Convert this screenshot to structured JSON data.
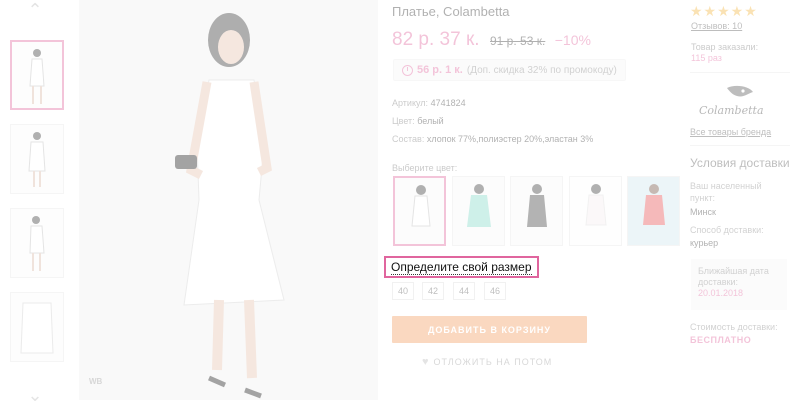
{
  "gallery": {
    "up_icon": "chevron-up",
    "down_icon": "chevron-down",
    "watermark": "WB"
  },
  "product": {
    "title": "Платье, Colambetta",
    "price": "82 р. 37 к.",
    "old_price": "91 р. 53 к.",
    "discount": "−10%",
    "promo_price": "56 р. 1 к.",
    "promo_note": "(Доп. скидка 32% по промокоду)",
    "article_label": "Артикул:",
    "article_value": "4741824",
    "color_label": "Цвет:",
    "color_value": "белый",
    "composition_label": "Состав:",
    "composition_value": "хлопок 77%,полиэстер 20%,эластан 3%",
    "choose_color": "Выберите цвет:",
    "swatch_colors": [
      "#f4f4f4",
      "#7fd8c6",
      "#3a3a3a",
      "#f7eef0",
      "#e54a4c"
    ],
    "size_link": "Определите свой размер",
    "sizes": [
      "40",
      "42",
      "44",
      "46"
    ],
    "add_to_cart": "ДОБАВИТЬ В КОРЗИНУ",
    "save_later": "ОТЛОЖИТЬ НА ПОТОМ"
  },
  "sidebar": {
    "stars": "★★★★★",
    "reviews": "Отзывов: 10",
    "ordered_label": "Товар заказали:",
    "ordered_value": "115 раз",
    "brand_name": "Colambetta",
    "brand_link": "Все товары бренда",
    "delivery_title": "Условия доставки",
    "city_label": "Ваш населенный пункт:",
    "city_value": "Минск",
    "method_label": "Способ доставки:",
    "method_value": "курьер",
    "nearest_label": "Ближайшая дата доставки:",
    "nearest_value": "20.01.2018",
    "cost_label": "Стоимость доставки:",
    "cost_value": "БЕСПЛАТНО"
  },
  "colors": {
    "accent": "#e0659e",
    "cart": "#f39b5d",
    "stars": "#f2b53c"
  }
}
